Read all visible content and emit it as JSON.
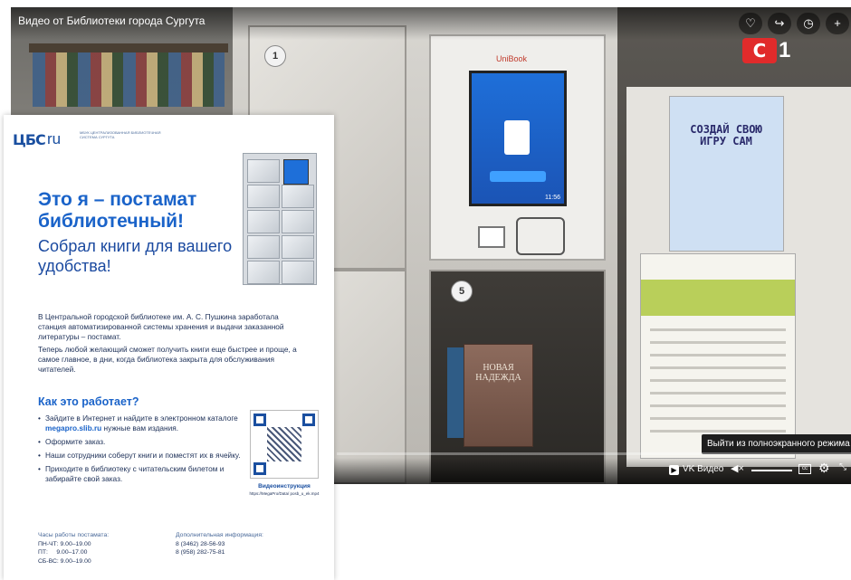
{
  "player": {
    "title": "Видео от Библиотеки города Сургута",
    "buttons": {
      "like_icon": "♡",
      "share_icon": "↪",
      "later_icon": "◷",
      "add_icon": "+"
    },
    "channel_logo": {
      "mark": "С",
      "num": "1"
    },
    "tooltip": "Выйти из полноэкранного режима",
    "progress": 0.0,
    "controls": {
      "brand": "VK Видео",
      "volume_icon": "◀×",
      "subtitles_icon": "cc",
      "settings_icon": "⚙",
      "fullscreen_icon": "⤡"
    }
  },
  "scene": {
    "locker_nums": [
      "1",
      "5"
    ],
    "kiosk_brand": "UniBook",
    "screen_time": "11:56",
    "poster_right_title": "СОЗДАЙ СВОЮ ИГРУ САМ",
    "book_title": "НОВАЯ НАДЕЖДА"
  },
  "poster": {
    "logo_mark": "ЦБС",
    "logo_ru": "ru",
    "logo_text": "МБУК Централизованная библиотечная система Сургута",
    "heading": "Это я – постамат библиотечный!",
    "subheading": "Собрал книги для вашего удобства!",
    "para1": "В Центральной городской библиотеке им. А. С. Пушкина заработала станция автоматизированной системы хранения и выдачи заказанной литературы – постамат.",
    "para2": "Теперь любой желающий сможет получить книги еще быстрее и проще, а самое главное, в дни, когда библиотека закрыта для обслуживания читателей.",
    "how_title": "Как это работает?",
    "steps": {
      "s1_pre": "Зайдите в Интернет и найдите в электронном каталоге ",
      "s1_link": "megapro.slib.ru",
      "s1_post": " нужные вам издания.",
      "s2": "Оформите заказ.",
      "s3": "Наши сотрудники соберут книги и поместят их в ячейку.",
      "s4": "Приходите в библиотеку с читательским билетом и забирайте свой заказ."
    },
    "qr_title": "Видеоинструкция",
    "qr_url": "https://MegaPro/Data/ posb_u_ek.mp4",
    "hours": {
      "label": "Часы работы постамата:",
      "line1": "ПН-ЧТ: 9.00–19.00",
      "line2": "ПТ:     9.00–17.00",
      "line3": "СБ-ВС: 9.00–19.00"
    },
    "contacts": {
      "label": "Дополнительная информация:",
      "phone1": "8 (3462) 28-56-93",
      "phone2": "8 (958) 282-75-81"
    }
  }
}
